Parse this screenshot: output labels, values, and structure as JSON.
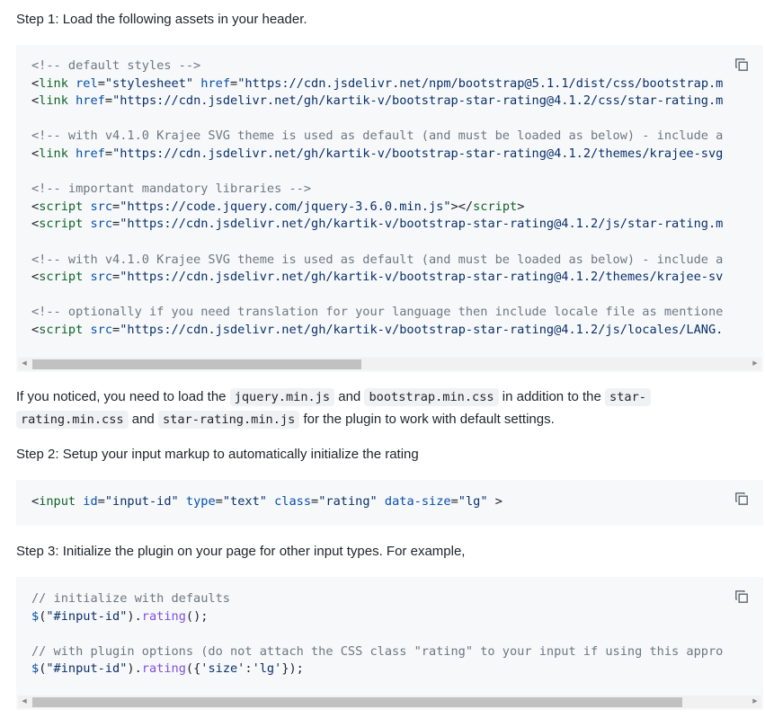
{
  "steps": {
    "step1": "Step 1: Load the following assets in your header.",
    "step2": "Step 2: Setup your input markup to automatically initialize the rating",
    "step3": "Step 3: Initialize the plugin on your page for other input types. For example,"
  },
  "notice": {
    "text1": "If you noticed, you need to load the ",
    "code1": "jquery.min.js",
    "text2": " and ",
    "code2": "bootstrap.min.css",
    "text3": " in addition to the ",
    "code3a": "star-",
    "code3b": "rating.min.css",
    "text4": " and ",
    "code4": "star-rating.min.js",
    "text5": " for the plugin to work with default settings."
  },
  "code_block_1": {
    "lines": [
      [
        {
          "t": "<!-- default styles -->",
          "c": "c"
        }
      ],
      [
        {
          "t": "<",
          "c": ""
        },
        {
          "t": "link",
          "c": "t"
        },
        {
          "t": " ",
          "c": ""
        },
        {
          "t": "rel",
          "c": "a"
        },
        {
          "t": "=",
          "c": ""
        },
        {
          "t": "\"stylesheet\"",
          "c": "s"
        },
        {
          "t": " ",
          "c": ""
        },
        {
          "t": "href",
          "c": "a"
        },
        {
          "t": "=",
          "c": ""
        },
        {
          "t": "\"https://cdn.jsdelivr.net/npm/bootstrap@5.1.1/dist/css/bootstrap.m",
          "c": "s"
        }
      ],
      [
        {
          "t": "<",
          "c": ""
        },
        {
          "t": "link",
          "c": "t"
        },
        {
          "t": " ",
          "c": ""
        },
        {
          "t": "href",
          "c": "a"
        },
        {
          "t": "=",
          "c": ""
        },
        {
          "t": "\"https://cdn.jsdelivr.net/gh/kartik-v/bootstrap-star-rating@4.1.2/css/star-rating.m",
          "c": "s"
        }
      ],
      [],
      [
        {
          "t": "<!-- with v4.1.0 Krajee SVG theme is used as default (and must be loaded as below) - include a",
          "c": "c"
        }
      ],
      [
        {
          "t": "<",
          "c": ""
        },
        {
          "t": "link",
          "c": "t"
        },
        {
          "t": " ",
          "c": ""
        },
        {
          "t": "href",
          "c": "a"
        },
        {
          "t": "=",
          "c": ""
        },
        {
          "t": "\"https://cdn.jsdelivr.net/gh/kartik-v/bootstrap-star-rating@4.1.2/themes/krajee-svg",
          "c": "s"
        }
      ],
      [],
      [
        {
          "t": "<!-- important mandatory libraries -->",
          "c": "c"
        }
      ],
      [
        {
          "t": "<",
          "c": ""
        },
        {
          "t": "script",
          "c": "t"
        },
        {
          "t": " ",
          "c": ""
        },
        {
          "t": "src",
          "c": "a"
        },
        {
          "t": "=",
          "c": ""
        },
        {
          "t": "\"https://code.jquery.com/jquery-3.6.0.min.js\"",
          "c": "s"
        },
        {
          "t": "></",
          "c": ""
        },
        {
          "t": "script",
          "c": "t"
        },
        {
          "t": ">",
          "c": ""
        }
      ],
      [
        {
          "t": "<",
          "c": ""
        },
        {
          "t": "script",
          "c": "t"
        },
        {
          "t": " ",
          "c": ""
        },
        {
          "t": "src",
          "c": "a"
        },
        {
          "t": "=",
          "c": ""
        },
        {
          "t": "\"https://cdn.jsdelivr.net/gh/kartik-v/bootstrap-star-rating@4.1.2/js/star-rating.m",
          "c": "s"
        }
      ],
      [],
      [
        {
          "t": "<!-- with v4.1.0 Krajee SVG theme is used as default (and must be loaded as below) - include a",
          "c": "c"
        }
      ],
      [
        {
          "t": "<",
          "c": ""
        },
        {
          "t": "script",
          "c": "t"
        },
        {
          "t": " ",
          "c": ""
        },
        {
          "t": "src",
          "c": "a"
        },
        {
          "t": "=",
          "c": ""
        },
        {
          "t": "\"https://cdn.jsdelivr.net/gh/kartik-v/bootstrap-star-rating@4.1.2/themes/krajee-sv",
          "c": "s"
        }
      ],
      [],
      [
        {
          "t": "<!-- optionally if you need translation for your language then include locale file as mentione",
          "c": "c"
        }
      ],
      [
        {
          "t": "<",
          "c": ""
        },
        {
          "t": "script",
          "c": "t"
        },
        {
          "t": " ",
          "c": ""
        },
        {
          "t": "src",
          "c": "a"
        },
        {
          "t": "=",
          "c": ""
        },
        {
          "t": "\"https://cdn.jsdelivr.net/gh/kartik-v/bootstrap-star-rating@4.1.2/js/locales/LANG.",
          "c": "s"
        }
      ]
    ],
    "scroll_position": 0.0,
    "scroll_visible_fraction": 0.46
  },
  "code_block_2": {
    "lines": [
      [
        {
          "t": "<",
          "c": ""
        },
        {
          "t": "input",
          "c": "t"
        },
        {
          "t": " ",
          "c": ""
        },
        {
          "t": "id",
          "c": "a"
        },
        {
          "t": "=",
          "c": ""
        },
        {
          "t": "\"input-id\"",
          "c": "s"
        },
        {
          "t": " ",
          "c": ""
        },
        {
          "t": "type",
          "c": "a"
        },
        {
          "t": "=",
          "c": ""
        },
        {
          "t": "\"text\"",
          "c": "s"
        },
        {
          "t": " ",
          "c": ""
        },
        {
          "t": "class",
          "c": "a"
        },
        {
          "t": "=",
          "c": ""
        },
        {
          "t": "\"rating\"",
          "c": "s"
        },
        {
          "t": " ",
          "c": ""
        },
        {
          "t": "data-size",
          "c": "a"
        },
        {
          "t": "=",
          "c": ""
        },
        {
          "t": "\"lg\"",
          "c": "s"
        },
        {
          "t": " >",
          "c": ""
        }
      ]
    ]
  },
  "code_block_3": {
    "lines": [
      [
        {
          "t": "// initialize with defaults",
          "c": "c"
        }
      ],
      [
        {
          "t": "$",
          "c": "a"
        },
        {
          "t": "(",
          "c": ""
        },
        {
          "t": "\"#input-id\"",
          "c": "s"
        },
        {
          "t": ").",
          "c": ""
        },
        {
          "t": "rating",
          "c": "f"
        },
        {
          "t": "();",
          "c": ""
        }
      ],
      [],
      [
        {
          "t": "// with plugin options (do not attach the CSS class \"rating\" to your input if using this appro",
          "c": "c"
        }
      ],
      [
        {
          "t": "$",
          "c": "a"
        },
        {
          "t": "(",
          "c": ""
        },
        {
          "t": "\"#input-id\"",
          "c": "s"
        },
        {
          "t": ").",
          "c": ""
        },
        {
          "t": "rating",
          "c": "f"
        },
        {
          "t": "({",
          "c": ""
        },
        {
          "t": "'size'",
          "c": "s"
        },
        {
          "t": ":",
          "c": ""
        },
        {
          "t": "'lg'",
          "c": "s"
        },
        {
          "t": "});",
          "c": ""
        }
      ]
    ],
    "scroll_position": 0.0,
    "scroll_visible_fraction": 0.91
  },
  "icons": {
    "copy": "copy-icon",
    "scroll_left": "scroll-left-arrow-icon",
    "scroll_right": "scroll-right-arrow-icon"
  },
  "colors": {
    "code_bg": "#f6f8fa",
    "comment": "#6e7781",
    "tag": "#116329",
    "attr": "#0550ae",
    "string": "#0a3069",
    "function": "#8250df"
  }
}
